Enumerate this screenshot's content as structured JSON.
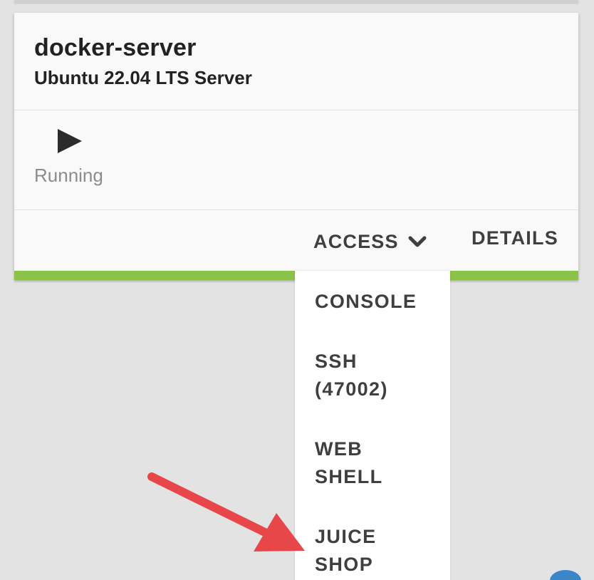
{
  "card": {
    "name": "docker-server",
    "os": "Ubuntu 22.04 LTS Server",
    "status": "Running",
    "status_icon": "play-icon"
  },
  "actions": {
    "access_label": "ACCESS",
    "access_icon": "chevron-down-icon",
    "details_label": "DETAILS"
  },
  "access_menu": {
    "items": [
      {
        "line1": "CONSOLE",
        "line2": ""
      },
      {
        "line1": "SSH",
        "line2": "(47002)"
      },
      {
        "line1": "WEB",
        "line2": "SHELL"
      },
      {
        "line1": "JUICE",
        "line2": "SHOP"
      }
    ]
  },
  "annotation": {
    "arrow_color": "#e8474a",
    "arrow_target": "access_menu.items.3"
  },
  "colors": {
    "accent": "#8bc34a",
    "background": "#e2e3e2",
    "card": "#f9f9f9",
    "text": "#3f3f3f",
    "status": "#8c8c8c"
  }
}
